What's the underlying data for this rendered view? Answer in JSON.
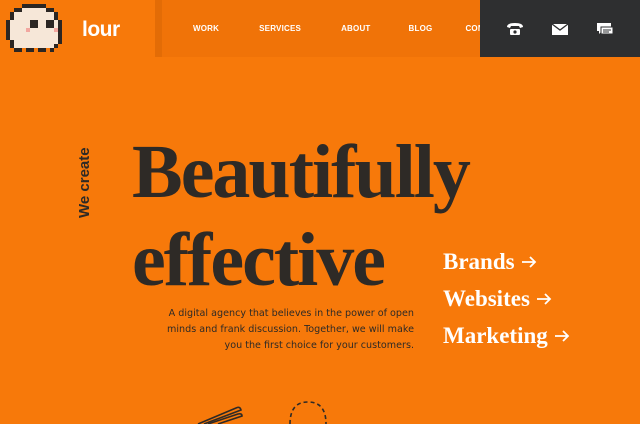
{
  "header": {
    "logo_text": "lour",
    "nav": [
      "WORK",
      "SERVICES",
      "ABOUT",
      "BLOG",
      "CONTACT"
    ],
    "contact_icons": [
      "phone-icon",
      "mail-icon",
      "chat-icon"
    ]
  },
  "hero": {
    "tagline": "We create",
    "headline_line1": "Beautifully",
    "headline_line2": "effective",
    "intro": "A digital agency that believes in the power of open minds and frank discussion. Together, we will make you the first choice for your customers.",
    "services": [
      "Brands",
      "Websites",
      "Marketing"
    ]
  },
  "colors": {
    "background": "#f7790a",
    "nav_background": "#f07308",
    "contact_bar": "#2e2f30",
    "text_dark": "#2e2a26",
    "text_light": "#ffffff"
  }
}
